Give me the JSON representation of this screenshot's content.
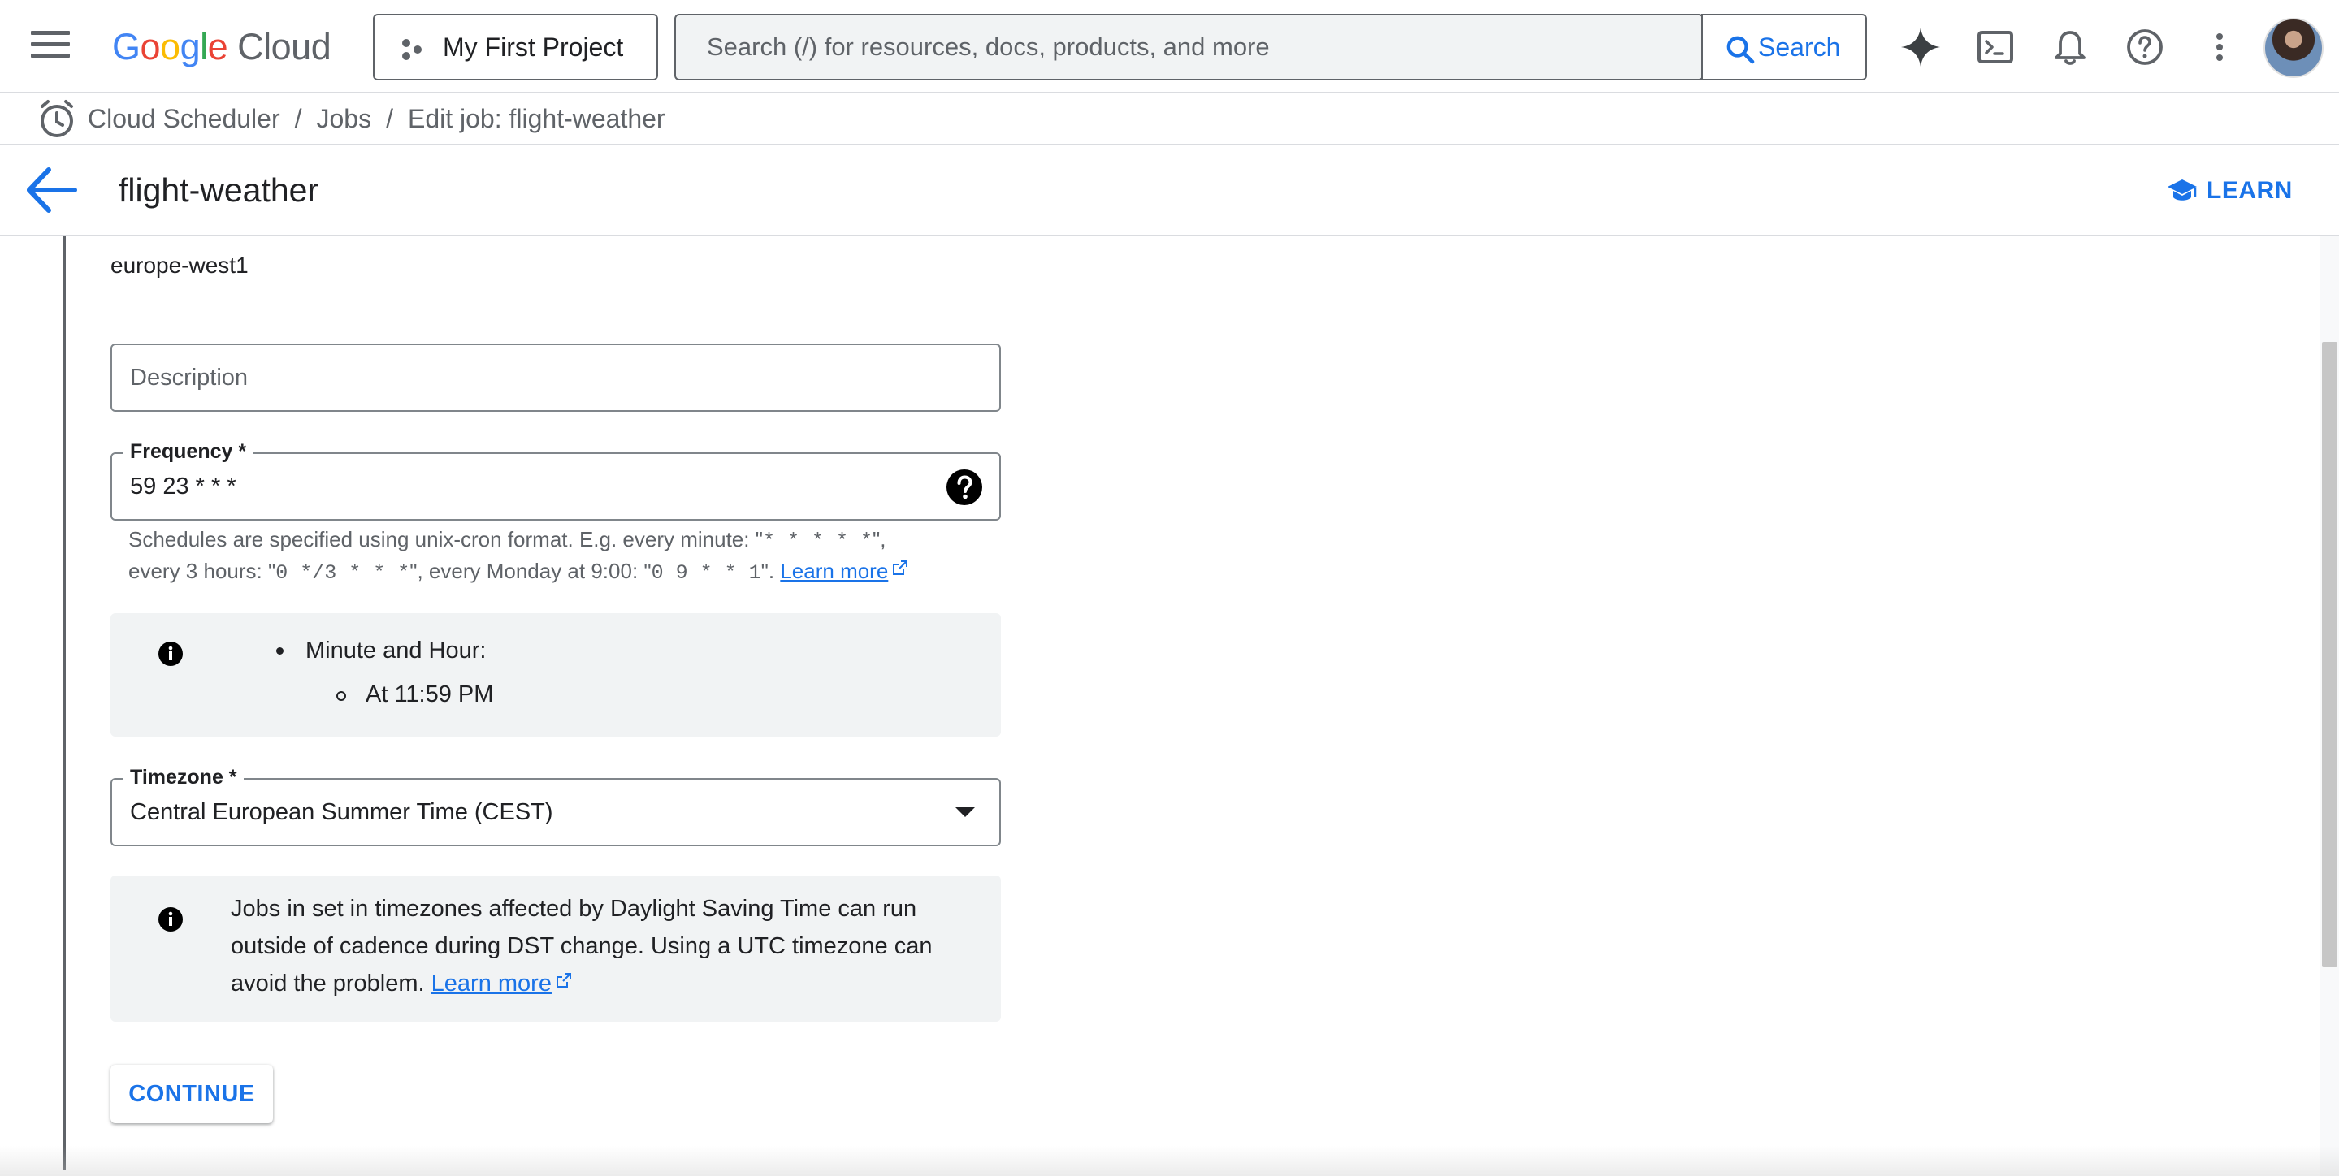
{
  "header": {
    "logo": {
      "google": "Google",
      "cloud": "Cloud"
    },
    "project_label": "My First Project",
    "search_placeholder": "Search (/) for resources, docs, products, and more",
    "search_button_label": "Search",
    "icons": [
      "gemini-sparkle-icon",
      "cloud-shell-icon",
      "notifications-bell-icon",
      "help-icon",
      "more-vert-icon"
    ]
  },
  "breadcrumb": {
    "items": [
      "Cloud Scheduler",
      "Jobs",
      "Edit job: flight-weather"
    ],
    "separator": "/"
  },
  "titlebar": {
    "title": "flight-weather",
    "learn_label": "LEARN"
  },
  "form": {
    "region_value": "europe-west1",
    "description": {
      "placeholder": "Description",
      "value": ""
    },
    "frequency": {
      "label": "Frequency *",
      "value": "59 23 * * *",
      "hint_parts": {
        "p1": "Schedules are specified using unix-cron format. E.g. every minute: \"",
        "m1": "* * * * *",
        "p2": "\",",
        "p3": "every 3 hours: \"",
        "m2": "0 */3 * * *",
        "p4": "\", every Monday at 9:00: \"",
        "m3": "0 9 * * 1",
        "p5": "\". ",
        "link": "Learn more"
      },
      "summary_heading": "Minute and Hour:",
      "summary_value": "At 11:59 PM"
    },
    "timezone": {
      "label": "Timezone *",
      "value": "Central European Summer Time (CEST)"
    },
    "dst_note": {
      "text": "Jobs in set in timezones affected by Daylight Saving Time can run outside of cadence during DST change. Using a UTC timezone can avoid the problem. ",
      "link": "Learn more"
    },
    "continue_label": "CONTINUE"
  },
  "colors": {
    "accent": "#1a73e8",
    "info_bg": "#f1f3f4",
    "border": "#80868b"
  }
}
